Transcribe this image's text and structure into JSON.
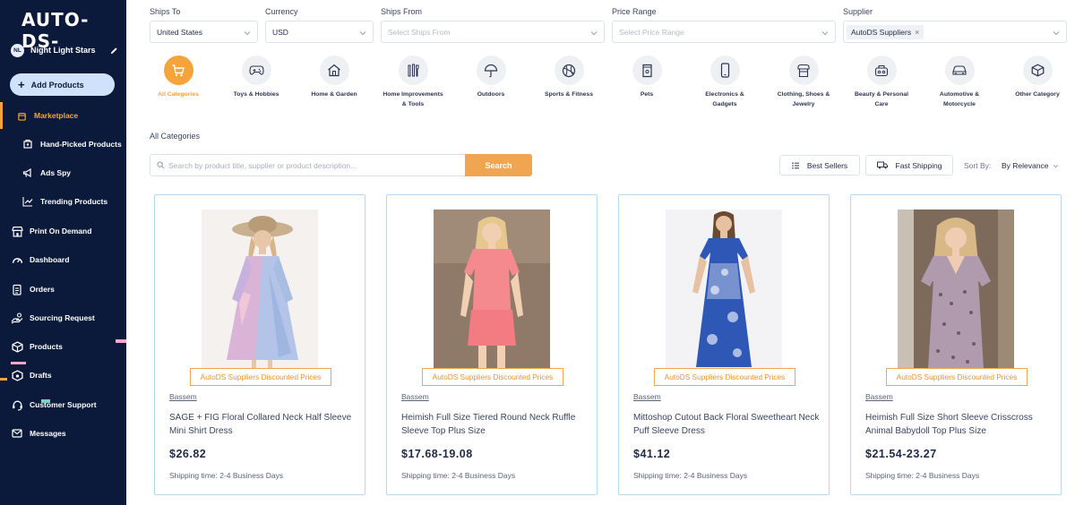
{
  "brand": {
    "logo_text": "AUTO-DS-"
  },
  "user": {
    "initials": "NL",
    "name": "Night Light Stars"
  },
  "sidebar": {
    "add_products_label": "Add Products",
    "items": [
      {
        "label": "Marketplace",
        "icon": "bag-icon"
      },
      {
        "label": "Hand-Picked Products",
        "icon": "product-box-icon"
      },
      {
        "label": "Ads Spy",
        "icon": "megaphone-icon"
      },
      {
        "label": "Trending Products",
        "icon": "chart-line-icon"
      },
      {
        "label": "Print On Demand",
        "icon": "print-shop-icon"
      },
      {
        "label": "Dashboard",
        "icon": "gauge-icon"
      },
      {
        "label": "Orders",
        "icon": "clipboard-icon"
      },
      {
        "label": "Sourcing Request",
        "icon": "hand-icon"
      },
      {
        "label": "Products",
        "icon": "cube-icon"
      },
      {
        "label": "Drafts",
        "icon": "draft-icon"
      },
      {
        "label": "Customer Support",
        "icon": "headset-icon"
      },
      {
        "label": "Messages",
        "icon": "envelope-icon"
      }
    ]
  },
  "filters": {
    "ships_to": {
      "label": "Ships To",
      "value": "United States"
    },
    "currency": {
      "label": "Currency",
      "value": "USD"
    },
    "ships_from": {
      "label": "Ships From",
      "placeholder": "Select Ships From"
    },
    "price_range": {
      "label": "Price Range",
      "placeholder": "Select Price Range"
    },
    "supplier": {
      "label": "Supplier",
      "chip": "AutoDS Suppliers"
    }
  },
  "categories": [
    {
      "label": "All Categories",
      "icon": "cart-icon",
      "active": true
    },
    {
      "label": "Toys & Hobbies",
      "icon": "gamepad-icon"
    },
    {
      "label": "Home & Garden",
      "icon": "house-icon"
    },
    {
      "label": "Home Improvements & Tools",
      "icon": "tools-icon"
    },
    {
      "label": "Outdoors",
      "icon": "umbrella-icon"
    },
    {
      "label": "Sports & Fitness",
      "icon": "ball-icon"
    },
    {
      "label": "Pets",
      "icon": "pet-food-icon"
    },
    {
      "label": "Electronics & Gadgets",
      "icon": "phone-icon"
    },
    {
      "label": "Clothing, Shoes & Jewelry",
      "icon": "shirt-icon"
    },
    {
      "label": "Beauty & Personal Care",
      "icon": "beauty-icon"
    },
    {
      "label": "Automotive & Motorcycle",
      "icon": "car-icon"
    },
    {
      "label": "Other Category",
      "icon": "package-icon"
    }
  ],
  "section_title": "All Categories",
  "search": {
    "placeholder": "Search by product title, supplier or product description...",
    "button": "Search"
  },
  "toolbar": {
    "best_sellers": "Best Sellers",
    "fast_shipping": "Fast Shipping",
    "sort_label": "Sort By:",
    "sort_value": "By Relevance"
  },
  "products": [
    {
      "badge": "AutoDS Suppliers Discounted Prices",
      "supplier": "Bassem",
      "title": "SAGE + FIG Floral Collared Neck Half Sleeve Mini Shirt Dress",
      "price": "$26.82",
      "shipping": "Shipping time: 2-4 Business Days"
    },
    {
      "badge": "AutoDS Suppliers Discounted Prices",
      "supplier": "Bassem",
      "title": "Heimish Full Size Tiered Round Neck Ruffle Sleeve Top Plus Size",
      "price": "$17.68-19.08",
      "shipping": "Shipping time: 2-4 Business Days"
    },
    {
      "badge": "AutoDS Suppliers Discounted Prices",
      "supplier": "Bassem",
      "title": "Mittoshop Cutout Back Floral Sweetheart Neck Puff Sleeve Dress",
      "price": "$41.12",
      "shipping": "Shipping time: 2-4 Business Days"
    },
    {
      "badge": "AutoDS Suppliers Discounted Prices",
      "supplier": "Bassem",
      "title": "Heimish Full Size Short Sleeve Crisscross Animal Babydoll Top Plus Size",
      "price": "$21.54-23.27",
      "shipping": "Shipping time: 2-4 Business Days"
    }
  ],
  "colors": {
    "sidebar_bg": "#0b1a3a",
    "accent": "#f5a33b",
    "add_button_bg": "#cfe2fb",
    "card_border": "#b9d9ee"
  }
}
